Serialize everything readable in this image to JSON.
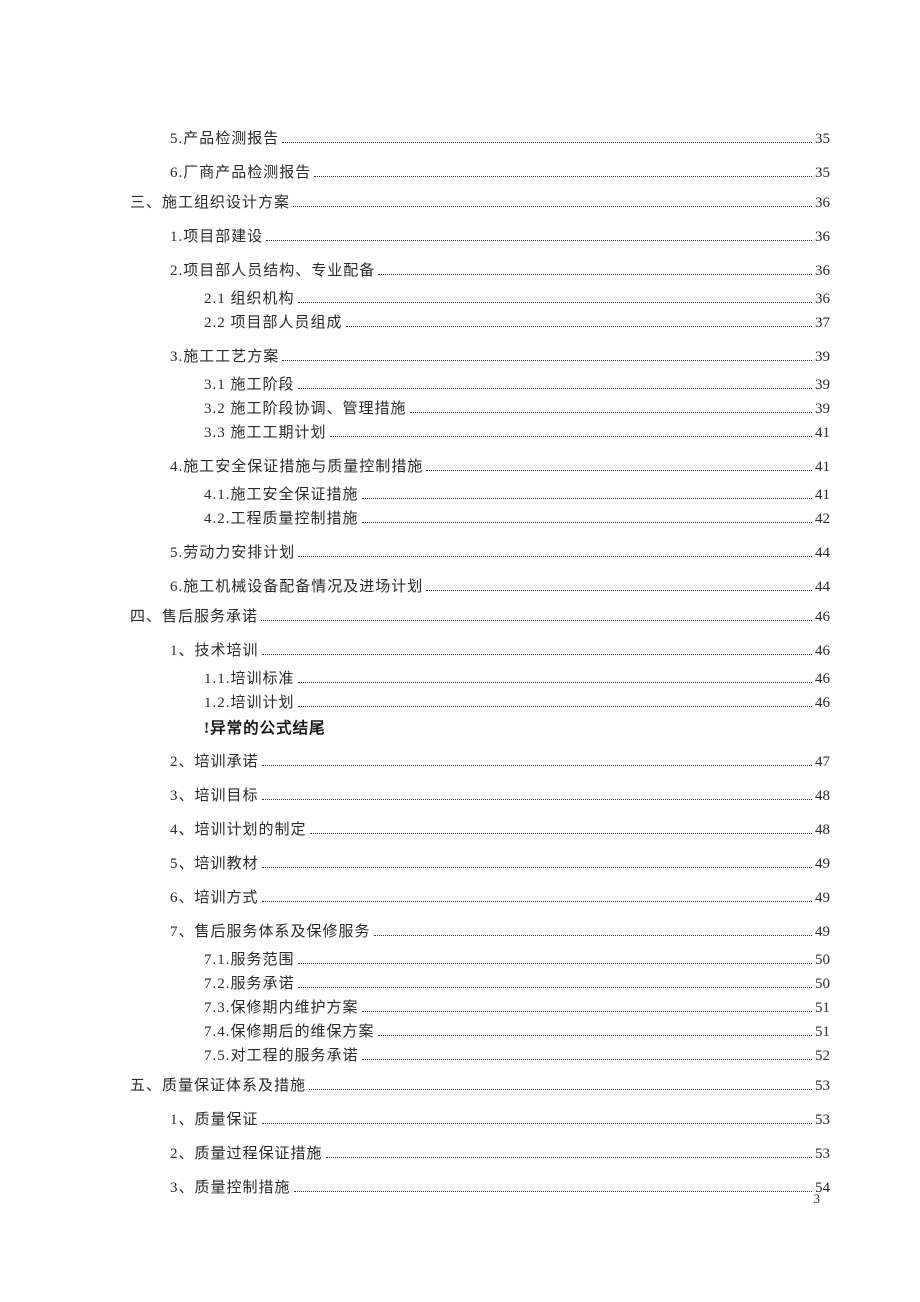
{
  "page_number": "3",
  "toc": [
    {
      "level": 2,
      "label": "5.产品检测报告",
      "page": "35"
    },
    {
      "level": 2,
      "label": "6.厂商产品检测报告",
      "page": "35"
    },
    {
      "level": 1,
      "label": "三、施工组织设计方案",
      "page": "36"
    },
    {
      "level": 2,
      "label": "1.项目部建设",
      "page": "36"
    },
    {
      "level": 2,
      "label": "2.项目部人员结构、专业配备",
      "page": "36"
    },
    {
      "level": 3,
      "label": "2.1 组织机构",
      "page": "36"
    },
    {
      "level": 3,
      "label": "2.2 项目部人员组成",
      "page": "37"
    },
    {
      "level": 2,
      "label": "3.施工工艺方案",
      "page": "39"
    },
    {
      "level": 3,
      "label": "3.1 施工阶段",
      "page": "39"
    },
    {
      "level": 3,
      "label": "3.2 施工阶段协调、管理措施",
      "page": "39"
    },
    {
      "level": 3,
      "label": "3.3 施工工期计划",
      "page": "41"
    },
    {
      "level": 2,
      "label": "4.施工安全保证措施与质量控制措施",
      "page": "41"
    },
    {
      "level": 3,
      "label": "4.1.施工安全保证措施",
      "page": "41"
    },
    {
      "level": 3,
      "label": "4.2.工程质量控制措施",
      "page": "42"
    },
    {
      "level": 2,
      "label": "5.劳动力安排计划",
      "page": "44"
    },
    {
      "level": 2,
      "label": "6.施工机械设备配备情况及进场计划",
      "page": "44"
    },
    {
      "level": 1,
      "label": "四、售后服务承诺",
      "page": "46"
    },
    {
      "level": 2,
      "label": "1、技术培训",
      "page": "46"
    },
    {
      "level": 3,
      "label": "1.1.培训标准",
      "page": "46"
    },
    {
      "level": 3,
      "label": "1.2.培训计划",
      "page": "46"
    },
    {
      "level": "err",
      "label": "!异常的公式结尾"
    },
    {
      "level": 2,
      "label": "2、培训承诺",
      "page": "47"
    },
    {
      "level": 2,
      "label": "3、培训目标",
      "page": "48"
    },
    {
      "level": 2,
      "label": "4、培训计划的制定",
      "page": "48"
    },
    {
      "level": 2,
      "label": "5、培训教材",
      "page": "49"
    },
    {
      "level": 2,
      "label": "6、培训方式",
      "page": "49"
    },
    {
      "level": 2,
      "label": "7、售后服务体系及保修服务",
      "page": "49"
    },
    {
      "level": 3,
      "label": "7.1.服务范围",
      "page": "50"
    },
    {
      "level": 3,
      "label": "7.2.服务承诺",
      "page": "50"
    },
    {
      "level": 3,
      "label": "7.3.保修期内维护方案",
      "page": "51"
    },
    {
      "level": 3,
      "label": "7.4.保修期后的维保方案",
      "page": "51"
    },
    {
      "level": 3,
      "label": "7.5.对工程的服务承诺",
      "page": "52"
    },
    {
      "level": 1,
      "label": "五、质量保证体系及措施",
      "page": "53"
    },
    {
      "level": 2,
      "label": "1、质量保证",
      "page": "53"
    },
    {
      "level": 2,
      "label": "2、质量过程保证措施",
      "page": "53"
    },
    {
      "level": 2,
      "label": "3、质量控制措施",
      "page": "54"
    }
  ]
}
